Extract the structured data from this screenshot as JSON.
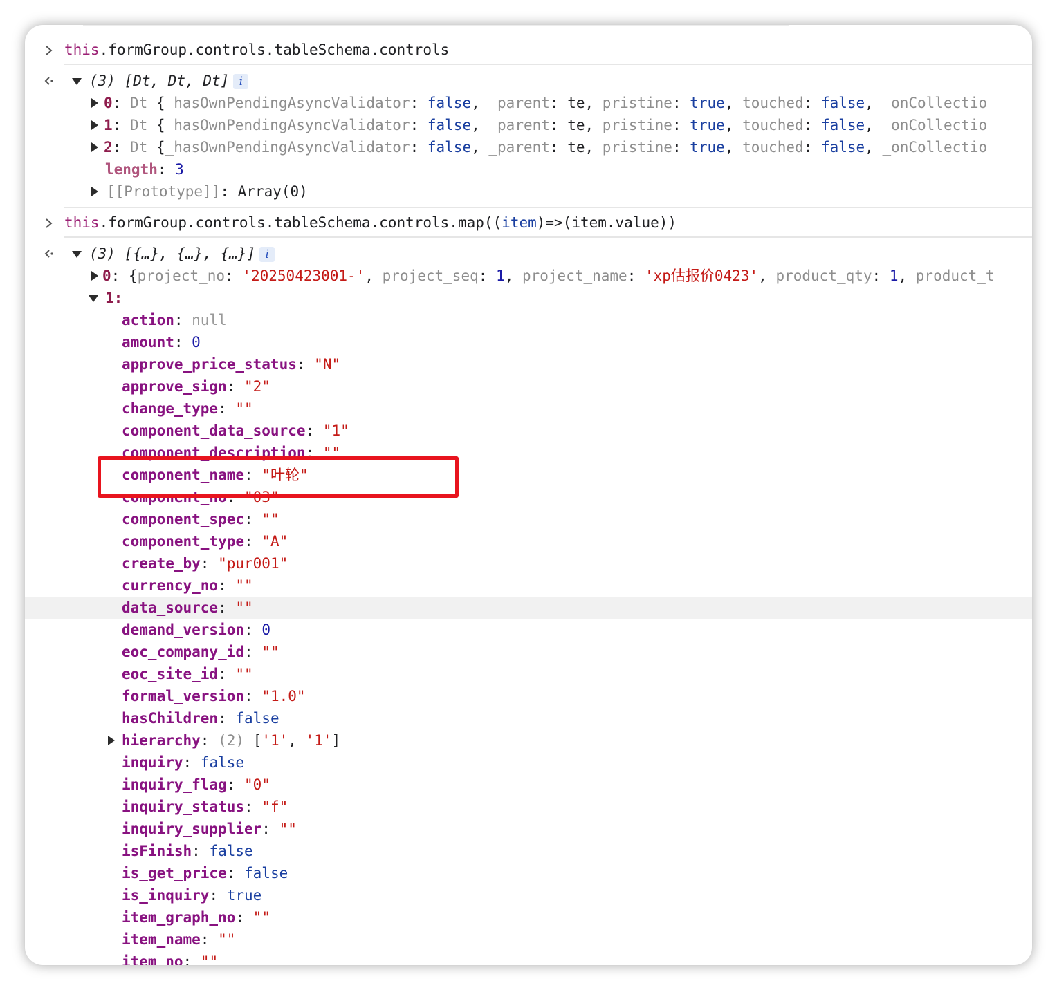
{
  "command1": {
    "this_kw": "this",
    "expr": ".formGroup.controls.tableSchema.controls"
  },
  "result1": {
    "summary": "(3) [Dt, Dt, Dt]",
    "info": "i",
    "rows": [
      {
        "index": "0",
        "ctor": "Dt",
        "brace": "{",
        "k1": "_hasOwnPendingAsyncValidator",
        "v1": "false",
        "k2": "_parent",
        "v2": "te",
        "k3": "pristine",
        "v3": "true",
        "k4": "touched",
        "v4": "false",
        "k5": "_onCollectio"
      },
      {
        "index": "1",
        "ctor": "Dt",
        "brace": "{",
        "k1": "_hasOwnPendingAsyncValidator",
        "v1": "false",
        "k2": "_parent",
        "v2": "te",
        "k3": "pristine",
        "v3": "true",
        "k4": "touched",
        "v4": "false",
        "k5": "_onCollectio"
      },
      {
        "index": "2",
        "ctor": "Dt",
        "brace": "{",
        "k1": "_hasOwnPendingAsyncValidator",
        "v1": "false",
        "k2": "_parent",
        "v2": "te",
        "k3": "pristine",
        "v3": "true",
        "k4": "touched",
        "v4": "false",
        "k5": "_onCollectio"
      }
    ],
    "length_key": "length",
    "length_val": "3",
    "proto_key": "[[Prototype]]",
    "proto_val": "Array(0)"
  },
  "command2": {
    "this_kw": "this",
    "expr_a": ".formGroup.controls.tableSchema.controls.map((",
    "param": "item",
    "expr_b": ")=>(item.value))"
  },
  "result2": {
    "summary": "(3) [{…}, {…}, {…}]",
    "info": "i",
    "row0": {
      "index": "0",
      "brace": "{",
      "k1": "project_no",
      "v1": "'20250423001-'",
      "k2": "project_seq",
      "v2": "1",
      "k3": "project_name",
      "v3": "'xp估报价0423'",
      "k4": "product_qty",
      "v4": "1",
      "k5": "product_t"
    },
    "row1_index": "1",
    "props": [
      {
        "key": "action",
        "val": "null"
      },
      {
        "key": "amount",
        "val": "0"
      },
      {
        "key": "approve_price_status",
        "val": "\"N\""
      },
      {
        "key": "approve_sign",
        "val": "\"2\""
      },
      {
        "key": "change_type",
        "val": "\"\""
      },
      {
        "key": "component_data_source",
        "val": "\"1\""
      },
      {
        "key": "component_description",
        "val": "\"\""
      },
      {
        "key": "component_name",
        "val": "\"叶轮\""
      },
      {
        "key": "component_no",
        "val": "\"03\""
      },
      {
        "key": "component_spec",
        "val": "\"\""
      },
      {
        "key": "component_type",
        "val": "\"A\""
      },
      {
        "key": "create_by",
        "val": "\"pur001\""
      },
      {
        "key": "currency_no",
        "val": "\"\""
      },
      {
        "key": "data_source",
        "val": "\"\""
      },
      {
        "key": "demand_version",
        "val": "0"
      },
      {
        "key": "eoc_company_id",
        "val": "\"\""
      },
      {
        "key": "eoc_site_id",
        "val": "\"\""
      },
      {
        "key": "formal_version",
        "val": "\"1.0\""
      },
      {
        "key": "hasChildren",
        "val": "false"
      },
      {
        "key": "hierarchy",
        "count": "(2)",
        "val": "['1', '1']"
      },
      {
        "key": "inquiry",
        "val": "false"
      },
      {
        "key": "inquiry_flag",
        "val": "\"0\""
      },
      {
        "key": "inquiry_status",
        "val": "\"f\""
      },
      {
        "key": "inquiry_supplier",
        "val": "\"\""
      },
      {
        "key": "isFinish",
        "val": "false"
      },
      {
        "key": "is_get_price",
        "val": "false"
      },
      {
        "key": "is_inquiry",
        "val": "true"
      },
      {
        "key": "item_graph_no",
        "val": "\"\""
      },
      {
        "key": "item_name",
        "val": "\"\""
      },
      {
        "key": "item_no",
        "val": "\"\""
      }
    ]
  },
  "highlight": {
    "color": "#e8141e",
    "target": "component_name"
  }
}
